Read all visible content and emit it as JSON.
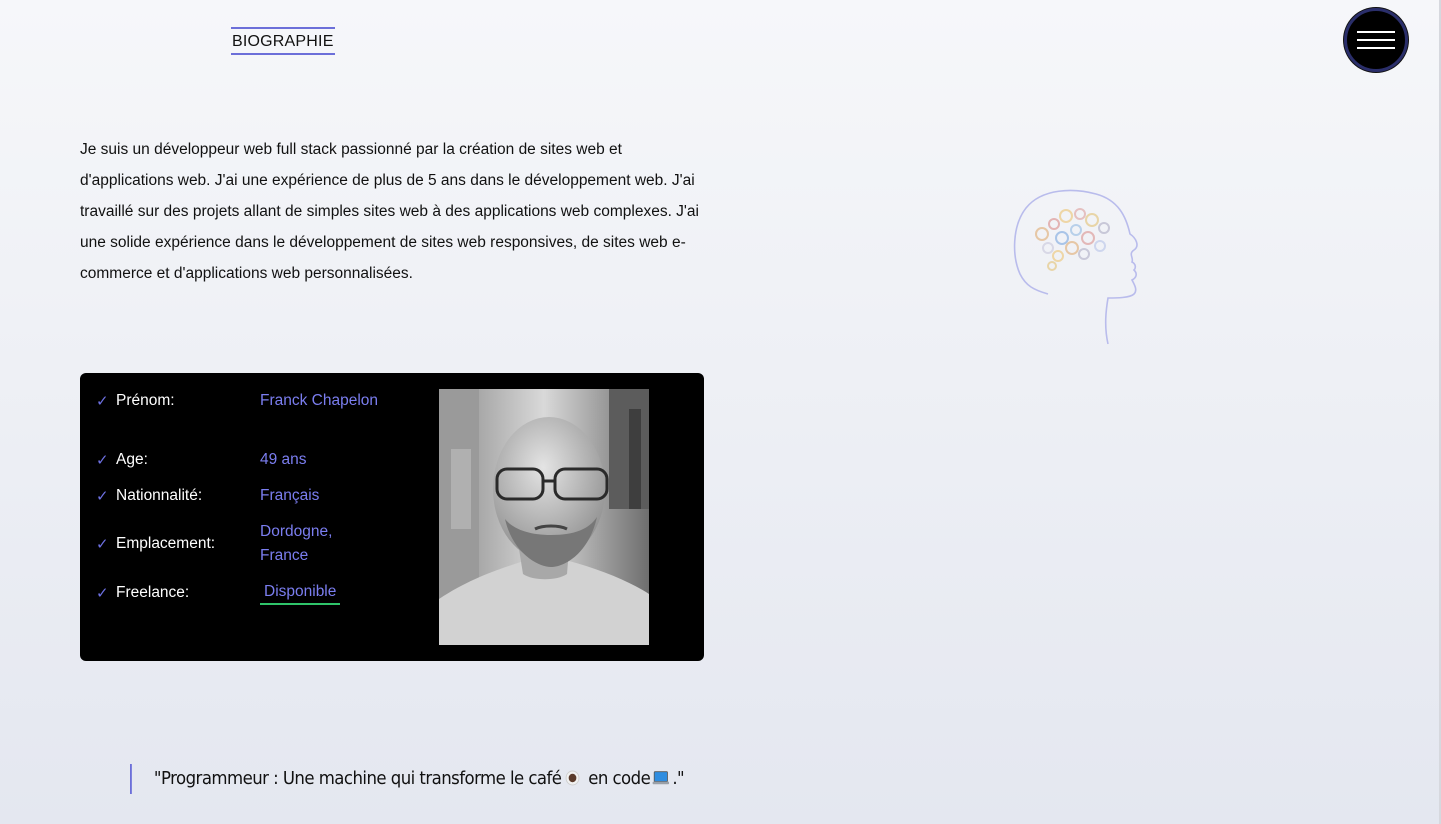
{
  "header": {
    "section_title": "BIOGRAPHIE",
    "menu_icon": "hamburger-menu-icon"
  },
  "bio": {
    "paragraph": "Je suis un développeur web full stack passionné par la création de sites web et d'applications web. J'ai une expérience de plus de 5 ans dans le développement web. J'ai travaillé sur des projets allant de simples sites web à des applications web complexes. J'ai une solide expérience dans le développement de sites web responsives, de sites web e-commerce et d'applications web personnalisées."
  },
  "profile": {
    "rows": [
      {
        "label": "Prénom:",
        "value": "Franck Chapelon"
      },
      {
        "label": "Age:",
        "value": "49 ans"
      },
      {
        "label": "Nationnalité:",
        "value": "Français"
      },
      {
        "label": "Emplacement:",
        "value": "Dordogne, France"
      },
      {
        "label": "Freelance:",
        "value": "Disponible"
      }
    ],
    "check_glyph": "✓",
    "accent_color": "#7b7ef0",
    "available_color": "#2fc46a"
  },
  "quote": {
    "text_before": "\"Programmeur : Une machine qui transforme le café",
    "text_middle": " en code",
    "text_after": ".\"",
    "coffee_icon": "coffee-cup-icon",
    "laptop_icon": "laptop-icon"
  },
  "theme": {
    "accent": "#6c6fd9",
    "card_bg": "#000000"
  }
}
